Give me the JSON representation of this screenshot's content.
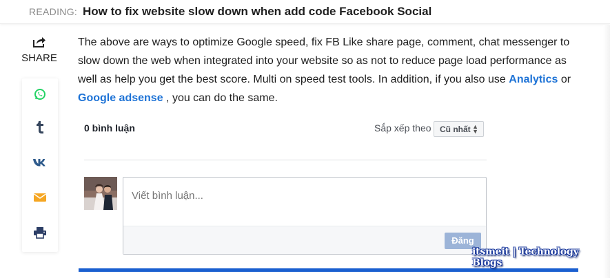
{
  "reading_bar": {
    "label": "READING:",
    "title": "How to fix website slow down when add code Facebook Social"
  },
  "share": {
    "label": "SHARE",
    "buttons": [
      {
        "icon": "whatsapp-icon",
        "color": "#25d366"
      },
      {
        "icon": "tumblr-icon",
        "color": "#36465d"
      },
      {
        "icon": "vk-icon",
        "color": "#4a76a8"
      },
      {
        "icon": "email-icon",
        "color": "#f5a623"
      },
      {
        "icon": "print-icon",
        "color": "#2c3e66"
      }
    ]
  },
  "article": {
    "text_before": "The above are ways to optimize Google speed, fix FB Like share page, comment, chat messenger to slow down the web when integrated into your website so as not to reduce page load performance as well as help you get the best score. Multi on speed test tools. In addition, if you also use",
    "link1": "Analytics",
    "between": "or",
    "link2": "Google adsense",
    "text_after": ", you can do the same."
  },
  "fb_comments": {
    "count_label": "0 bình luận",
    "sort_label": "Sắp xếp theo",
    "sort_value": "Cũ nhất",
    "input_placeholder": "Viết bình luận...",
    "post_button": "Đăng"
  },
  "watermark": "itsmeit | Technology Blogs",
  "colors": {
    "link": "#1e73d6",
    "accent_bar": "#1a5fd0",
    "post_button": "#9cb4d8"
  }
}
